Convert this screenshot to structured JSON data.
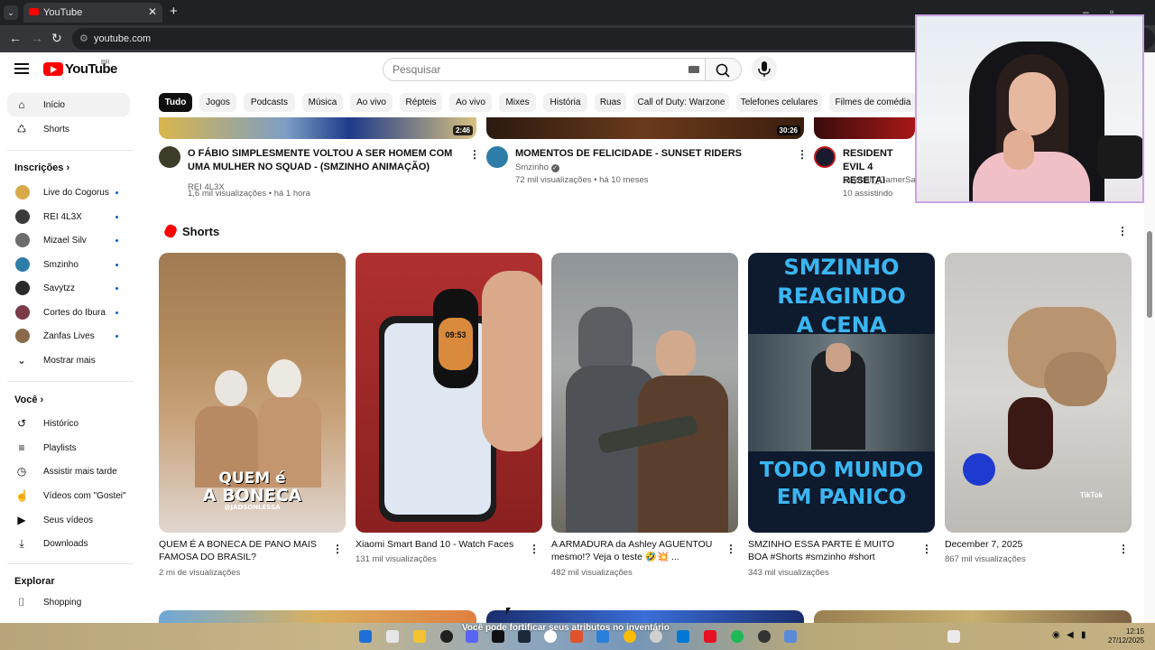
{
  "browser": {
    "tab_title": "YouTube",
    "url": "youtube.com",
    "new_tab": "+",
    "close": "✕"
  },
  "header": {
    "logo_text": "YouTube",
    "logo_region": "BR",
    "search_placeholder": "Pesquisar"
  },
  "sidebar": {
    "primary": [
      {
        "label": "Início",
        "icon": "home-icon"
      },
      {
        "label": "Shorts",
        "icon": "shorts-icon"
      }
    ],
    "subscriptions_heading": "Inscrições",
    "subscriptions": [
      {
        "label": "Live do Cogorus",
        "color": "#d8a94a"
      },
      {
        "label": "REI 4L3X",
        "color": "#3a3a3a"
      },
      {
        "label": "Mizael Silv",
        "color": "#6c6c6c"
      },
      {
        "label": "Smzinho",
        "color": "#2e7ca8"
      },
      {
        "label": "Savytzz",
        "color": "#2b2b2b"
      },
      {
        "label": "Cortes do Ibura",
        "color": "#7a3a4a"
      },
      {
        "label": "Zanfas Lives",
        "color": "#8a6a4a"
      }
    ],
    "show_more": "Mostrar mais",
    "you_heading": "Você",
    "you_items": [
      {
        "label": "Histórico",
        "icon": "history-icon"
      },
      {
        "label": "Playlists",
        "icon": "playlists-icon"
      },
      {
        "label": "Assistir mais tarde",
        "icon": "watch-later-icon"
      },
      {
        "label": "Vídeos com \"Gostei\"",
        "icon": "like-icon"
      },
      {
        "label": "Seus vídeos",
        "icon": "your-videos-icon"
      },
      {
        "label": "Downloads",
        "icon": "download-icon"
      }
    ],
    "explore_heading": "Explorar",
    "explore_items": [
      {
        "label": "Shopping",
        "icon": "shopping-icon"
      }
    ]
  },
  "chips": [
    "Tudo",
    "Jogos",
    "Podcasts",
    "Música",
    "Ao vivo",
    "Répteis",
    "Ao vivo",
    "Mixes",
    "História",
    "Ruas",
    "Call of Duty: Warzone",
    "Telefones celulares",
    "Filmes de comédia"
  ],
  "videos": [
    {
      "title": "O FÁBIO SIMPLESMENTE VOLTOU A SER HOMEM COM UMA MULHER NO SQUAD - (SMZINHO ANIMAÇÃO)",
      "channel": "REI 4L3X",
      "meta": "1,6 mil visualizações • há 1 hora",
      "duration": "2:46"
    },
    {
      "title": "MOMENTOS DE FELICIDADE - SUNSET RIDERS",
      "channel": "Smzinho",
      "meta": "72 mil visualizações • há 10 meses",
      "duration": "30:26"
    },
    {
      "title": "RESIDENT EVIL 4 RESETA!",
      "channel": "Saymon_GamerSax",
      "meta": "10 assistindo",
      "duration": ""
    }
  ],
  "shorts_section": {
    "title": "Shorts",
    "items": [
      {
        "caption": "QUEM É A BONECA DE PANO MAIS FAMOSA DO BRASIL?",
        "views": "2 mi de visualizações",
        "overlay1": "QUEM é",
        "overlay2": "A BONECA",
        "overlay3": "@JADSONLESSA"
      },
      {
        "caption": "Xiaomi Smart Band 10 - Watch Faces",
        "views": "131 mil visualizações",
        "overlay1": "09:53",
        "overlay2": "",
        "overlay3": ""
      },
      {
        "caption": "A ARMADURA da Ashley AGUENTOU mesmo!? Veja o teste 🤣💥 ...",
        "views": "482 mil visualizações",
        "overlay1": "",
        "overlay2": "",
        "overlay3": ""
      },
      {
        "caption": "SMZINHO ESSA PARTE É MUITO BOA #Shorts #smzinho #short",
        "views": "343 mil visualizações",
        "overlay1": "SMZINHO",
        "overlay2": "REAGINDO",
        "overlay3": "A CENA",
        "overlay4": "TODO MUNDO",
        "overlay5": "EM PANICO"
      },
      {
        "caption": "December 7, 2025",
        "views": "867 mil visualizações",
        "overlay1": "TikTok",
        "overlay2": "",
        "overlay3": ""
      }
    ]
  },
  "taskbar": {
    "notice": "Você pode fortificar seus atributos no inventário",
    "time": "12:15",
    "date": "27/12/2025"
  }
}
